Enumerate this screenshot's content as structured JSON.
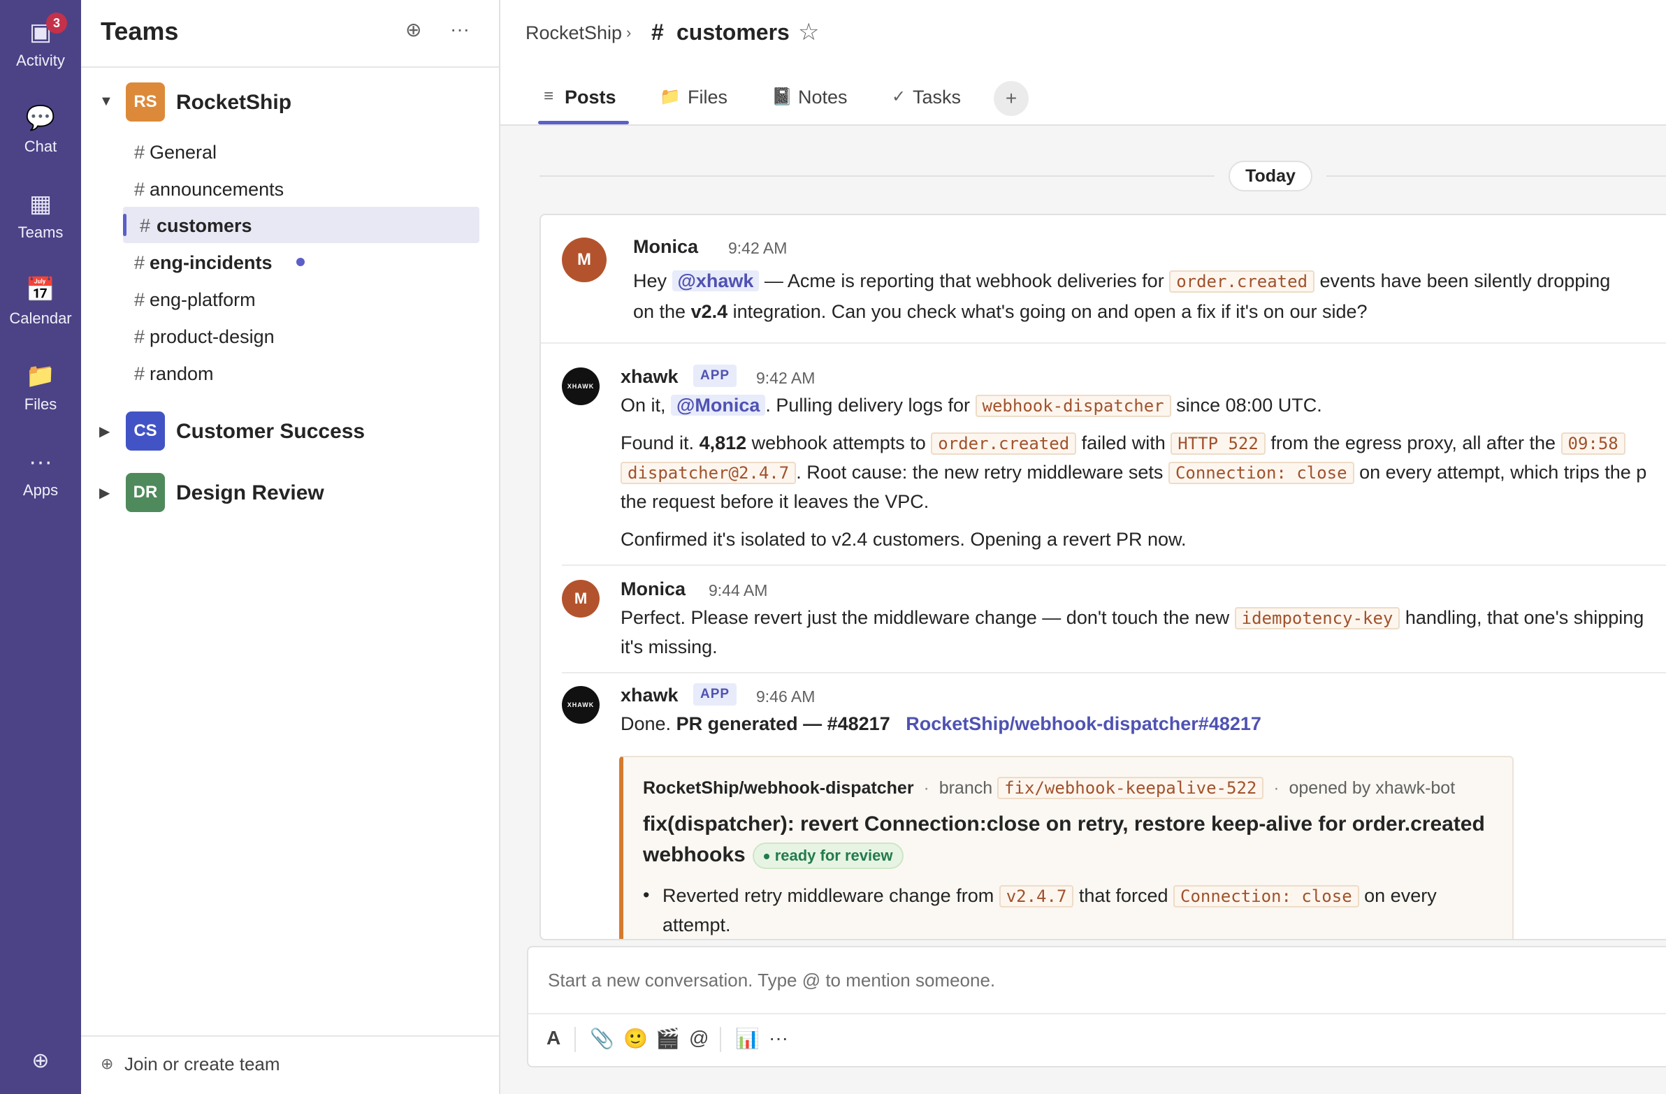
{
  "rail": {
    "items": [
      {
        "label": "Activity",
        "icon": "▣",
        "badge": "3"
      },
      {
        "label": "Chat",
        "icon": "💬"
      },
      {
        "label": "Teams",
        "icon": "▦"
      },
      {
        "label": "Calendar",
        "icon": "📅"
      },
      {
        "label": "Files",
        "icon": "📁"
      },
      {
        "label": "Apps",
        "icon": "···"
      }
    ],
    "bottom_icon": "⊕"
  },
  "teams_panel": {
    "title": "Teams",
    "new_icon": "⊕",
    "more_icon": "···",
    "teams": [
      {
        "initials": "RS",
        "name": "RocketShip",
        "color": "#dc8a3a",
        "expanded": true
      },
      {
        "initials": "CS",
        "name": "Customer Success",
        "color": "#4254c5",
        "expanded": false
      },
      {
        "initials": "DR",
        "name": "Design Review",
        "color": "#4e8a5c",
        "expanded": false
      }
    ],
    "channels": [
      {
        "hash": "#",
        "name": "General"
      },
      {
        "hash": "#",
        "name": "announcements"
      },
      {
        "hash": "#",
        "name": "customers"
      },
      {
        "hash": "#",
        "name": "eng-incidents"
      },
      {
        "hash": "#",
        "name": "eng-platform"
      },
      {
        "hash": "#",
        "name": "product-design"
      },
      {
        "hash": "#",
        "name": "random"
      }
    ],
    "join_icon": "⊕",
    "join_label": "Join or create team"
  },
  "header": {
    "team": "RocketShip",
    "sep": "›",
    "hash": "#",
    "channel": "customers",
    "star": "☆",
    "tabs": [
      {
        "icon": "≡",
        "label": "Posts"
      },
      {
        "icon": "📁",
        "label": "Files"
      },
      {
        "icon": "📓",
        "label": "Notes"
      },
      {
        "icon": "✓",
        "label": "Tasks"
      }
    ],
    "add_tab": "+"
  },
  "feed": {
    "day": "Today",
    "m1": {
      "avatar": "M",
      "author": "Monica",
      "time": "9:42 AM",
      "l1_a": "Hey ",
      "l1_mention": "@xhawk",
      "l1_b": " — Acme is reporting that webhook deliveries for ",
      "l1_code": "order.created",
      "l1_c": " events have been silently dropping",
      "l2_a": "on the ",
      "l2_bold": "v2.4",
      "l2_b": " integration. Can you check what's going on and open a fix if it's on our side?"
    },
    "m2": {
      "avatar": "XHAWK",
      "author": "xhawk",
      "badge": "APP",
      "time": "9:42 AM",
      "l1_a": "On it, ",
      "l1_mention": "@Monica",
      "l1_b": ". Pulling delivery logs for ",
      "l1_code": "webhook-dispatcher",
      "l1_c": " since 08:00 UTC.",
      "l2_a": "Found it. ",
      "l2_bold": "4,812",
      "l2_b": " webhook attempts to ",
      "l2_code1": "order.created",
      "l2_c": " failed with ",
      "l2_code2": "HTTP 522",
      "l2_d": " from the egress proxy, all after the ",
      "l2_code3": "09:58",
      "l3_code": "dispatcher@2.4.7",
      "l3_a": ". Root cause: the new retry middleware sets ",
      "l3_code2": "Connection: close",
      "l3_b": " on every attempt, which trips the p",
      "l4": "the request before it leaves the VPC.",
      "l5": "Confirmed it's isolated to v2.4 customers. Opening a revert PR now."
    },
    "m3": {
      "avatar": "M",
      "author": "Monica",
      "time": "9:44 AM",
      "l1_a": "Perfect. Please revert just the middleware change — don't touch the new ",
      "l1_code": "idempotency-key",
      "l1_b": " handling, that one's shipping",
      "l2": "it's missing."
    },
    "m4": {
      "avatar": "XHAWK",
      "author": "xhawk",
      "badge": "APP",
      "time": "9:46 AM",
      "l1_a": "Done. ",
      "l1_bold": "PR generated — #48217",
      "l1_link": "RocketShip/webhook-dispatcher#48217",
      "pr": {
        "repo": "RocketShip/webhook-dispatcher",
        "dot1": "·",
        "branch_label": "branch",
        "branch": "fix/webhook-keepalive-522",
        "dot2": "·",
        "opened": "opened by xhawk-bot",
        "title1": "fix(dispatcher): revert Connection:close on retry, restore keep-alive for order.created",
        "title2": "webhooks",
        "status": "ready for review",
        "b1_a": "Reverted retry middleware change from ",
        "b1_code": "v2.4.7",
        "b1_b": " that forced ",
        "b1_code2": "Connection: close",
        "b1_c": " on every",
        "b1_2": "attempt."
      }
    }
  },
  "compose": {
    "placeholder": "Start a new conversation. Type @ to mention someone.",
    "tools": [
      "A",
      "📎",
      "🙂",
      "🎬",
      "@",
      "📊",
      "···"
    ]
  },
  "colors": {
    "rail": "#4b4386",
    "accent": "#5b5fc7",
    "pr_border": "#d47b30"
  }
}
